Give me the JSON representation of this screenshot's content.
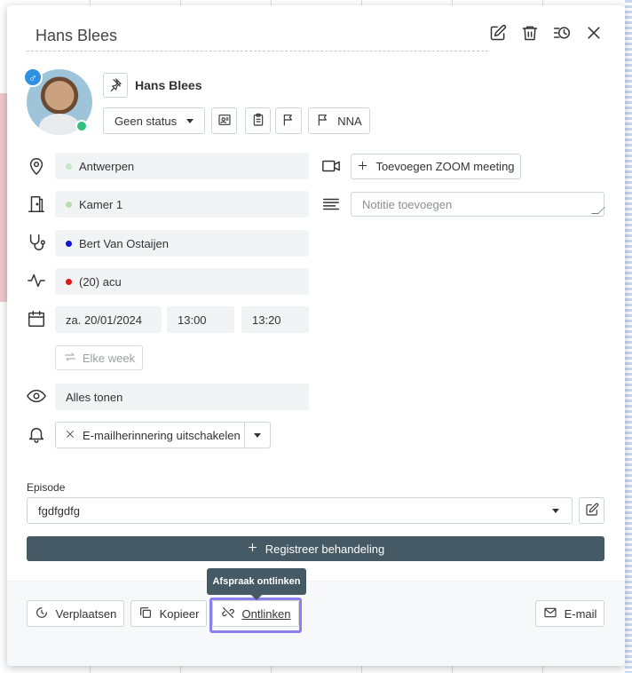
{
  "header": {
    "title": "Hans Blees",
    "actions": [
      "edit-icon",
      "trash-icon",
      "history-icon",
      "close-icon"
    ]
  },
  "patient": {
    "name": "Hans Blees",
    "gender_symbol": "♂",
    "status_select": "Geen status",
    "flag_label": "NNA",
    "online_color": "#2ec27e"
  },
  "details": {
    "location": {
      "value": "Antwerpen",
      "dot_color": "#c9e6c9"
    },
    "room": {
      "value": "Kamer 1",
      "dot_color": "#b8dbb0"
    },
    "practitioner": {
      "value": "Bert Van Ostaijen",
      "dot_color": "#1016c9"
    },
    "treatment": {
      "value": "(20) acu",
      "dot_color": "#e01818"
    },
    "date": "za. 20/01/2024",
    "time_start": "13:00",
    "time_end": "13:20",
    "repeat_button": "Elke week",
    "visibility": "Alles tonen",
    "reminder": "E-mailherinnering uitschakelen"
  },
  "right_column": {
    "zoom_button": "Toevoegen ZOOM meeting",
    "note_placeholder": "Notitie toevoegen"
  },
  "episode": {
    "label": "Episode",
    "value": "fgdfgdfg"
  },
  "primary_action": "Registreer behandeling",
  "footer": {
    "move_button": "Verplaatsen",
    "copy_button": "Kopieer",
    "unlink_button": "Ontlinken",
    "email_button": "E-mail",
    "tooltip": "Afspraak ontlinken"
  },
  "colors": {
    "primary": "#455a64",
    "focus": "#8c7ff0",
    "gender_badge": "#2f8fe0"
  }
}
